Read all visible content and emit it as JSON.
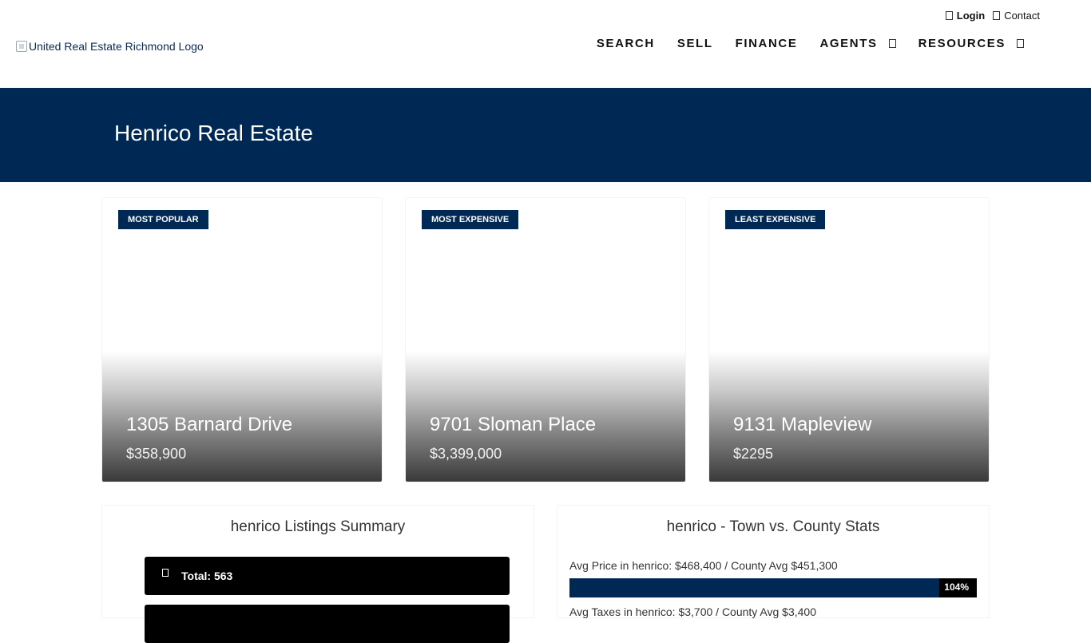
{
  "header": {
    "logo_alt": "United Real Estate Richmond Logo",
    "util_links": [
      {
        "label": "Login",
        "icon": "user-icon"
      },
      {
        "label": "Contact",
        "icon": "envelope-icon"
      }
    ],
    "nav": [
      {
        "label": "SEARCH",
        "has_dropdown": false
      },
      {
        "label": "SELL",
        "has_dropdown": false
      },
      {
        "label": "FINANCE",
        "has_dropdown": false
      },
      {
        "label": "AGENTS",
        "has_dropdown": true
      },
      {
        "label": "RESOURCES",
        "has_dropdown": true
      }
    ]
  },
  "hero": {
    "title": "Henrico Real Estate"
  },
  "cards": [
    {
      "badge": "MOST POPULAR",
      "address": "1305 Barnard Drive",
      "price": "$358,900"
    },
    {
      "badge": "MOST EXPENSIVE",
      "address": "9701 Sloman Place",
      "price": "$3,399,000"
    },
    {
      "badge": "LEAST EXPENSIVE",
      "address": "9131 Mapleview",
      "price": "$2295"
    }
  ],
  "summary": {
    "title": "henrico Listings Summary",
    "rows": [
      {
        "label": "Total: 563",
        "icon": "home-icon"
      }
    ]
  },
  "stats": {
    "title": "henrico - Town vs. County Stats",
    "items": [
      {
        "label": "Avg Price in henrico: $468,400 / County Avg $451,300",
        "percent_label": "104%",
        "fill_percent": 90.7
      },
      {
        "label": "Avg Taxes in henrico: $3,700 / County Avg $3,400",
        "percent_label": "",
        "fill_percent": 0
      }
    ]
  },
  "colors": {
    "brand": "#002855",
    "bar_track": "#000000"
  }
}
